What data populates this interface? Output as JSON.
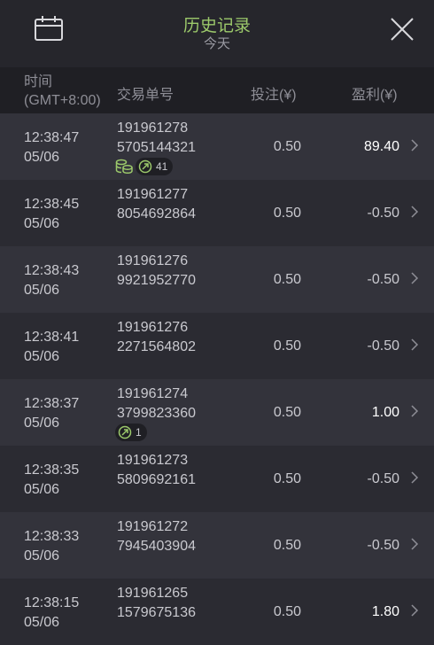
{
  "header": {
    "title": "历史记录",
    "subtitle": "今天"
  },
  "columns": {
    "time": "时间",
    "time_zone": "(GMT+8:00)",
    "order_id": "交易单号",
    "bet": "投注(¥)",
    "profit": "盈利(¥)"
  },
  "colors": {
    "accent": "#9cc96b",
    "background": "#2b2b32",
    "row_alt": "#33333b",
    "header_bg": "#26262c"
  },
  "icons": {
    "left": "calendar-icon",
    "right": "close-icon",
    "row": "chevron-right-icon"
  },
  "rows": [
    {
      "time": "12:38:47",
      "date": "05/06",
      "id1": "191961278",
      "id2": "5705144321",
      "bet": "0.50",
      "profit": "89.40",
      "badge_count": "41"
    },
    {
      "time": "12:38:45",
      "date": "05/06",
      "id1": "191961277",
      "id2": "8054692864",
      "bet": "0.50",
      "profit": "-0.50"
    },
    {
      "time": "12:38:43",
      "date": "05/06",
      "id1": "191961276",
      "id2": "9921952770",
      "bet": "0.50",
      "profit": "-0.50"
    },
    {
      "time": "12:38:41",
      "date": "05/06",
      "id1": "191961276",
      "id2": "2271564802",
      "bet": "0.50",
      "profit": "-0.50"
    },
    {
      "time": "12:38:37",
      "date": "05/06",
      "id1": "191961274",
      "id2": "3799823360",
      "bet": "0.50",
      "profit": "1.00",
      "badge_count": "1"
    },
    {
      "time": "12:38:35",
      "date": "05/06",
      "id1": "191961273",
      "id2": "5809692161",
      "bet": "0.50",
      "profit": "-0.50"
    },
    {
      "time": "12:38:33",
      "date": "05/06",
      "id1": "191961272",
      "id2": "7945403904",
      "bet": "0.50",
      "profit": "-0.50"
    },
    {
      "time": "12:38:15",
      "date": "05/06",
      "id1": "191961265",
      "id2": "1579675136",
      "bet": "0.50",
      "profit": "1.80"
    }
  ]
}
